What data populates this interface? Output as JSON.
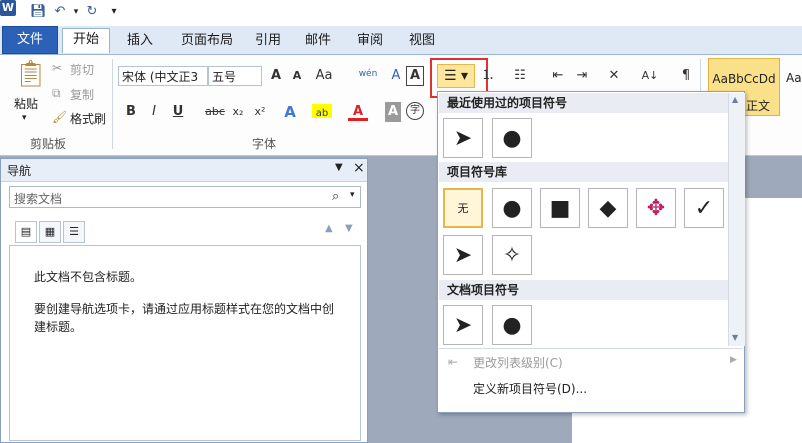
{
  "qat": {
    "icons": [
      "word-icon",
      "save-icon",
      "undo-icon",
      "redo-icon",
      "customize-icon"
    ],
    "word_letter": "W"
  },
  "tabs": [
    "文件",
    "开始",
    "插入",
    "页面布局",
    "引用",
    "邮件",
    "审阅",
    "视图"
  ],
  "clipboard": {
    "paste": "粘贴",
    "cut": "剪切",
    "copy": "复制",
    "format_painter": "格式刷",
    "group": "剪贴板"
  },
  "font": {
    "name": "宋体 (中文正3",
    "size": "五号",
    "group": "字体",
    "bold": "B",
    "italic": "I",
    "underline": "U",
    "strike": "abc",
    "sub": "x₂",
    "sup": "x²",
    "grow": "A",
    "shrink": "A",
    "case": "Aa",
    "clear": "A",
    "text_effect": "A",
    "font_color": "A",
    "char_shade": "A",
    "enclose": "字",
    "wen": "wén"
  },
  "styles": {
    "sample": "AaBbCcDd",
    "sample2": "Aa",
    "partial": "正文"
  },
  "nav": {
    "title": "导航",
    "search_placeholder": "搜索文档",
    "no_headings": "此文档不包含标题。",
    "hint": "要创建导航选项卡，请通过应用标题样式在您的文档中创建标题。"
  },
  "bullets_menu": {
    "recent_header": "最近使用过的项目符号",
    "library_header": "项目符号库",
    "document_header": "文档项目符号",
    "none_label": "无",
    "change_level": "更改列表级别(C)",
    "define_new": "定义新项目符号(D)...",
    "recent": [
      "➤",
      "●"
    ],
    "library_row1": [
      "●",
      "■",
      "◆",
      "✥",
      "✓"
    ],
    "library_row2": [
      "➤",
      "✧"
    ],
    "document": [
      "➤",
      "●"
    ]
  },
  "colors": {
    "accent": "#2b62b8",
    "highlight": "#e03030",
    "selected": "#ffe69a"
  }
}
